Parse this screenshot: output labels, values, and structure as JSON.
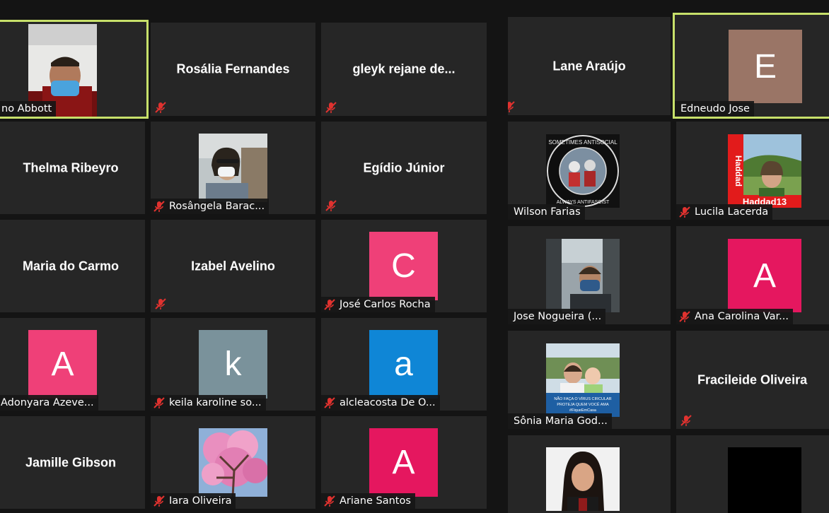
{
  "window": {
    "title": ""
  },
  "participants": [
    {
      "id": "t1",
      "display_name": "",
      "label": "no Abbott",
      "avatar": "",
      "avatar_color": "",
      "muted": false,
      "active": true,
      "media": "photo"
    },
    {
      "id": "t2",
      "display_name": "Rosália Fernandes",
      "label": "",
      "avatar": "",
      "avatar_color": "",
      "muted": true,
      "active": false,
      "media": "none"
    },
    {
      "id": "t3",
      "display_name": "gleyk rejane de...",
      "label": "",
      "avatar": "",
      "avatar_color": "",
      "muted": true,
      "active": false,
      "media": "none"
    },
    {
      "id": "t4",
      "display_name": "Lane Araújo",
      "label": "",
      "avatar": "",
      "avatar_color": "",
      "muted": true,
      "active": false,
      "media": "none"
    },
    {
      "id": "t5",
      "display_name": "",
      "label": "Edneudo Jose",
      "avatar": "E",
      "avatar_color": "#9a7566",
      "muted": false,
      "active": true,
      "media": "letter"
    },
    {
      "id": "t6",
      "display_name": "Thelma Ribeyro",
      "label": "",
      "avatar": "",
      "avatar_color": "",
      "muted": false,
      "active": false,
      "media": "none"
    },
    {
      "id": "t7",
      "display_name": "",
      "label": "Rosângela Barac...",
      "avatar": "",
      "avatar_color": "",
      "muted": true,
      "active": false,
      "media": "photo"
    },
    {
      "id": "t8",
      "display_name": "Egídio Júnior",
      "label": "",
      "avatar": "",
      "avatar_color": "",
      "muted": true,
      "active": false,
      "media": "none"
    },
    {
      "id": "t9",
      "display_name": "",
      "label": "Wilson Farias",
      "avatar": "",
      "avatar_color": "",
      "muted": true,
      "active": false,
      "media": "photo"
    },
    {
      "id": "t10",
      "display_name": "",
      "label": "Lucila Lacerda",
      "avatar": "",
      "avatar_color": "",
      "muted": true,
      "active": false,
      "media": "photo"
    },
    {
      "id": "t11",
      "display_name": "Maria do Carmo",
      "label": "",
      "avatar": "",
      "avatar_color": "",
      "muted": false,
      "active": false,
      "media": "none"
    },
    {
      "id": "t12",
      "display_name": "Izabel Avelino",
      "label": "",
      "avatar": "",
      "avatar_color": "",
      "muted": true,
      "active": false,
      "media": "none"
    },
    {
      "id": "t13",
      "display_name": "",
      "label": "José Carlos Rocha",
      "avatar": "C",
      "avatar_color": "#ef4078",
      "muted": true,
      "active": false,
      "media": "letter"
    },
    {
      "id": "t14",
      "display_name": "",
      "label": "Jose Nogueira (...",
      "avatar": "",
      "avatar_color": "",
      "muted": true,
      "active": false,
      "media": "photo"
    },
    {
      "id": "t15",
      "display_name": "",
      "label": "Ana Carolina Var...",
      "avatar": "A",
      "avatar_color": "#e5175f",
      "muted": true,
      "active": false,
      "media": "letter"
    },
    {
      "id": "t16",
      "display_name": "",
      "label": "Adonyara Azeve...",
      "avatar": "A",
      "avatar_color": "#ef4078",
      "muted": false,
      "active": false,
      "media": "letter"
    },
    {
      "id": "t17",
      "display_name": "",
      "label": "keila karoline so...",
      "avatar": "k",
      "avatar_color": "#7a929b",
      "muted": true,
      "active": false,
      "media": "letter"
    },
    {
      "id": "t18",
      "display_name": "",
      "label": "alcleacosta De O...",
      "avatar": "a",
      "avatar_color": "#0f86d6",
      "muted": true,
      "active": false,
      "media": "letter"
    },
    {
      "id": "t19",
      "display_name": "",
      "label": "Sônia Maria God...",
      "avatar": "",
      "avatar_color": "",
      "muted": true,
      "active": false,
      "media": "photo"
    },
    {
      "id": "t20",
      "display_name": "Fracileide Oliveira",
      "label": "",
      "avatar": "",
      "avatar_color": "",
      "muted": true,
      "active": false,
      "media": "none"
    },
    {
      "id": "t21",
      "display_name": "Jamille Gibson",
      "label": "",
      "avatar": "",
      "avatar_color": "",
      "muted": false,
      "active": false,
      "media": "none"
    },
    {
      "id": "t22",
      "display_name": "",
      "label": "Iara Oliveira",
      "avatar": "",
      "avatar_color": "",
      "muted": true,
      "active": false,
      "media": "photo"
    },
    {
      "id": "t23",
      "display_name": "",
      "label": "Ariane Santos",
      "avatar": "A",
      "avatar_color": "#e5175f",
      "muted": true,
      "active": false,
      "media": "letter"
    },
    {
      "id": "t24",
      "display_name": "",
      "label": "",
      "avatar": "",
      "avatar_color": "",
      "muted": false,
      "active": false,
      "media": "photo"
    },
    {
      "id": "t25",
      "display_name": "",
      "label": "",
      "avatar": "",
      "avatar_color": "",
      "muted": false,
      "active": false,
      "media": "photo"
    }
  ],
  "photo_text": {
    "wilson_ring_top": "SOMETIMES ANTISOCIAL",
    "wilson_ring_bottom": "ALWAYS ANTIFASCIST",
    "lucila_banner": "Haddad",
    "lucila_banner_bottom": "Haddad13",
    "sonia_caption_1": "NÃO FAÇA O VÍRUS CIRCULAR",
    "sonia_caption_2": "PROTEJA QUEM VOCÊ AMA",
    "sonia_caption_3": "#FiqueEmCasa"
  },
  "icons": {
    "mute": "mic-muted-icon"
  },
  "colors": {
    "tile_bg": "#262626",
    "page_bg": "#141414",
    "active_border": "#c7e06a",
    "muted_icon": "#e0322f"
  }
}
